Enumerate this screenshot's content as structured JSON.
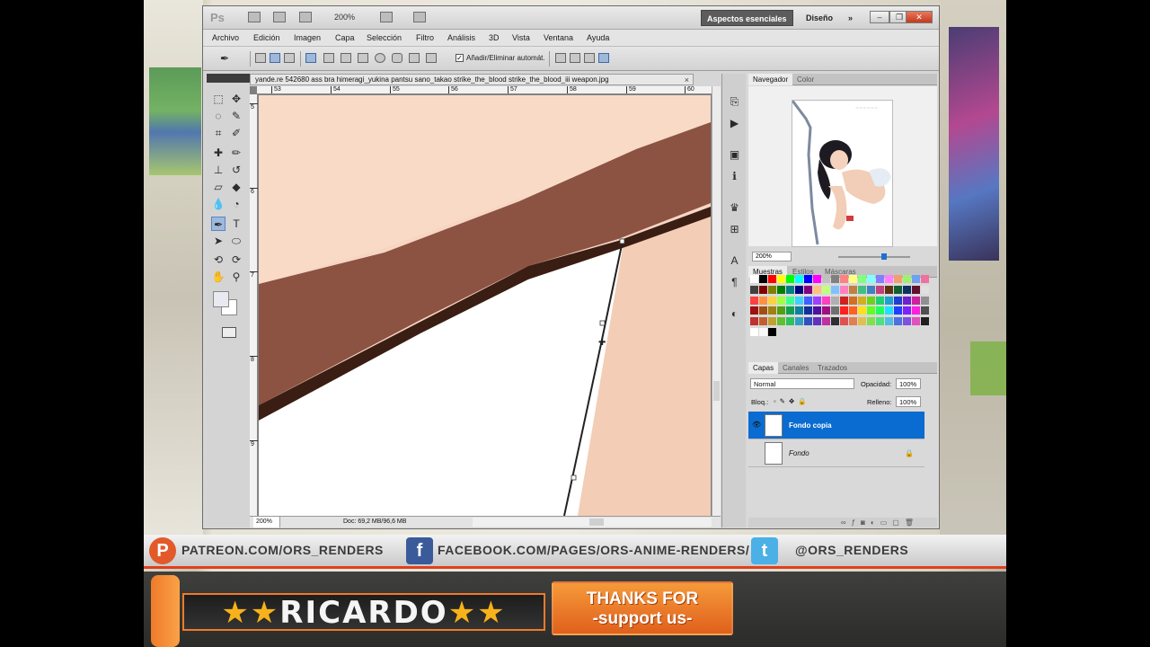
{
  "app": {
    "logo": "Ps",
    "zoom": "200%",
    "workspace_active": "Aspectos esenciales",
    "workspace_other": "Diseño",
    "more": "»"
  },
  "menu": [
    "Archivo",
    "Edición",
    "Imagen",
    "Capa",
    "Selección",
    "Filtro",
    "Análisis",
    "3D",
    "Vista",
    "Ventana",
    "Ayuda"
  ],
  "options": {
    "auto_add_delete": "Añadir/Eliminar automát.",
    "auto_checked": "✓"
  },
  "document": {
    "tab_title": "yande.re 542680 ass bra himeragi_yukina pantsu sano_takao strike_the_blood strike_the_blood_iii weapon.jpg",
    "close": "×",
    "ruler_top": [
      "53",
      "54",
      "55",
      "56",
      "57",
      "58",
      "59",
      "60"
    ],
    "ruler_left": [
      "5",
      "6",
      "7",
      "8",
      "9"
    ],
    "status_zoom": "200%",
    "status_doc": "Doc: 69,2 MB/96,6 MB"
  },
  "panels": {
    "navigator_tabs": [
      "Navegador",
      "Color"
    ],
    "navigator_zoom": "200%",
    "swatch_tabs": [
      "Muestras",
      "Estilos",
      "Máscaras"
    ],
    "layers_tabs": [
      "Capas",
      "Canales",
      "Trazados"
    ],
    "blend_mode": "Normal",
    "opacity_label": "Opacidad:",
    "opacity_value": "100%",
    "lock_label": "Bloq.:",
    "fill_label": "Relleno:",
    "fill_value": "100%",
    "layers": [
      {
        "name": "Fondo copia",
        "visible": true,
        "selected": true
      },
      {
        "name": "Fondo",
        "visible": false,
        "selected": false
      }
    ]
  },
  "swatch_colors": [
    "#ffffff",
    "#000000",
    "#ff0000",
    "#ffff00",
    "#00ff00",
    "#00ffff",
    "#0000ff",
    "#ff00ff",
    "#c0c0c0",
    "#808080",
    "#ff8080",
    "#ffff80",
    "#80ff80",
    "#80ffff",
    "#8080ff",
    "#ff80ff",
    "#f0a070",
    "#a0f070",
    "#70a0f0",
    "#f070a0",
    "#404040",
    "#800000",
    "#808000",
    "#008000",
    "#008080",
    "#000080",
    "#800080",
    "#ffc080",
    "#c0ff80",
    "#80c0ff",
    "#ff80c0",
    "#c08040",
    "#40c080",
    "#4080c0",
    "#c04080",
    "#603010",
    "#106030",
    "#103060",
    "#601030",
    "#e0e0e0",
    "#ff4040",
    "#ff9040",
    "#ffd040",
    "#a0ff40",
    "#40ff90",
    "#40d0ff",
    "#4060ff",
    "#a040ff",
    "#ff40c0",
    "#b0b0b0",
    "#d02020",
    "#d07020",
    "#d0b020",
    "#70d020",
    "#20d070",
    "#20a0d0",
    "#2040d0",
    "#7020d0",
    "#d020a0",
    "#909090",
    "#a01010",
    "#a05010",
    "#a08010",
    "#50a010",
    "#10a050",
    "#1080a0",
    "#1030a0",
    "#5010a0",
    "#a01080",
    "#707070",
    "#ff2020",
    "#ff6020",
    "#ffe020",
    "#60ff20",
    "#20ff60",
    "#20e0ff",
    "#2040ff",
    "#8020ff",
    "#ff20e0",
    "#505050",
    "#c03030",
    "#c06030",
    "#c0a030",
    "#60c030",
    "#30c060",
    "#30a0c0",
    "#3050c0",
    "#6030c0",
    "#c030a0",
    "#303030",
    "#e05050",
    "#e08050",
    "#e0c050",
    "#80e050",
    "#50e080",
    "#50c0e0",
    "#5070e0",
    "#8050e0",
    "#e050c0",
    "#202020",
    "#ffffff",
    "#f8f8f8",
    "#000000"
  ],
  "banner": {
    "patreon": "PATREON.COM/ORS_RENDERS",
    "facebook": "FACEBOOK.COM/PAGES/ORS-ANIME-RENDERS/",
    "twitter": "@ORS_RENDERS",
    "name": "RICARDO",
    "stars": "★★",
    "thanks_line1": "THANKS FOR",
    "thanks_line2": "-support us-"
  }
}
